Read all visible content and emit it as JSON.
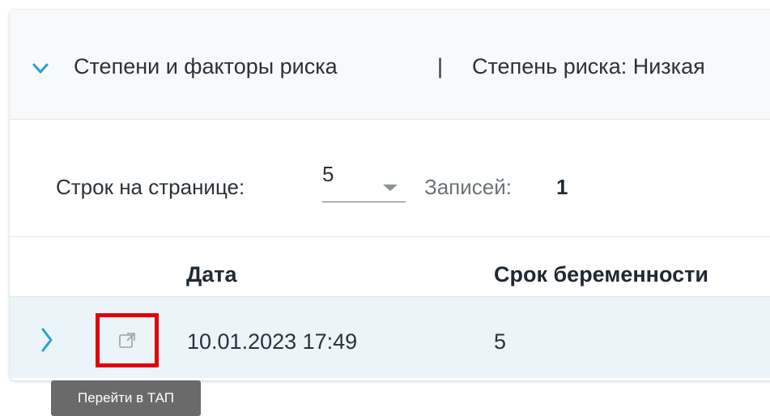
{
  "section": {
    "title": "Степени и факторы риска",
    "separator": "|",
    "risk_label": "Степень риска: Низкая"
  },
  "pager": {
    "rows_per_page_label": "Строк на странице:",
    "rows_per_page_value": "5",
    "records_label": "Записей:",
    "records_count": "1"
  },
  "table": {
    "columns": [
      "Дата",
      "Срок беременности"
    ],
    "rows": [
      {
        "date": "10.01.2023 17:49",
        "term": "5"
      }
    ]
  },
  "tooltip": {
    "text": "Перейти в ТАП"
  },
  "colors": {
    "accent": "#2a9fd6",
    "highlight_border": "#e3000b",
    "row_background": "#eaf4f9",
    "tooltip_background": "#6a6a6a"
  },
  "icons": {
    "section_toggle": "chevron-down-icon",
    "row_expand": "chevron-right-icon",
    "open_tap": "external-link-icon"
  }
}
